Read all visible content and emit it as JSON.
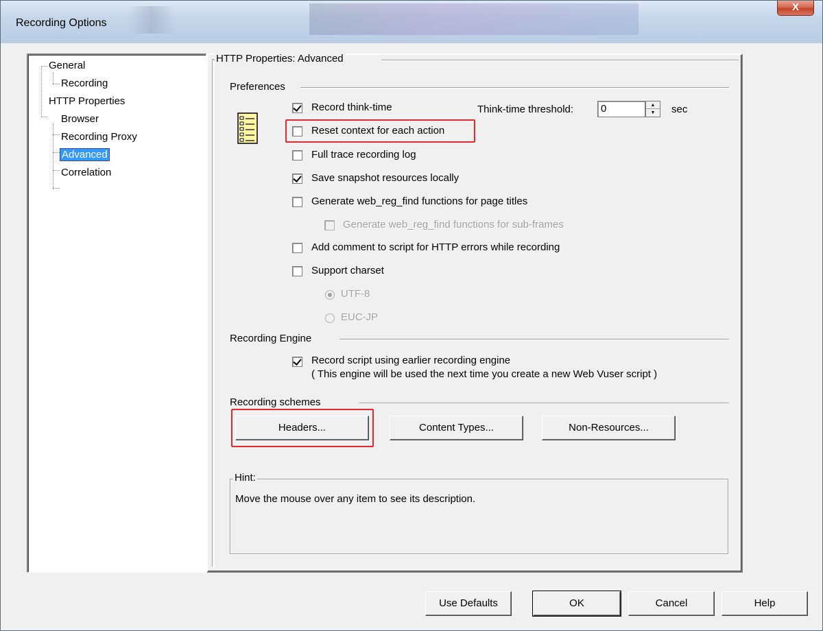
{
  "window": {
    "title": "Recording Options",
    "close_label": "X"
  },
  "tree": {
    "items": [
      {
        "label": "General"
      },
      {
        "label": "Recording"
      },
      {
        "label": "HTTP Properties"
      },
      {
        "label": "Browser"
      },
      {
        "label": "Recording Proxy"
      },
      {
        "label": "Advanced",
        "selected": true
      },
      {
        "label": "Correlation"
      }
    ]
  },
  "panel": {
    "title": "HTTP Properties: Advanced",
    "preferences": {
      "label": "Preferences",
      "record_think_time": {
        "label": "Record think-time",
        "checked": true
      },
      "think_time_threshold": {
        "label": "Think-time threshold:",
        "value": "0",
        "unit": "sec"
      },
      "reset_context": {
        "label": "Reset context for each action",
        "checked": false
      },
      "full_trace": {
        "label": "Full trace recording log",
        "checked": false
      },
      "save_snapshot": {
        "label": "Save snapshot resources locally",
        "checked": true
      },
      "gen_reg_find": {
        "label": "Generate web_reg_find functions for page titles",
        "checked": false
      },
      "gen_reg_find_sub": {
        "label": "Generate web_reg_find functions for sub-frames",
        "checked": false,
        "disabled": true
      },
      "add_comment": {
        "label": "Add comment to script for HTTP errors while recording",
        "checked": false
      },
      "support_charset": {
        "label": "Support charset",
        "checked": false
      },
      "charset_utf8": {
        "label": "UTF-8",
        "selected": true,
        "disabled": true
      },
      "charset_eucjp": {
        "label": "EUC-JP",
        "selected": false,
        "disabled": true
      }
    },
    "recording_engine": {
      "label": "Recording Engine",
      "earlier_engine": {
        "label": "Record script using earlier recording engine",
        "note": "( This engine will be used the next time you create a new Web Vuser script )",
        "checked": true
      }
    },
    "recording_schemes": {
      "label": "Recording schemes",
      "headers_button": "Headers...",
      "content_types_button": "Content Types...",
      "non_resources_button": "Non-Resources..."
    },
    "hint": {
      "label": "Hint:",
      "text": "Move the mouse over any item to see its description."
    }
  },
  "footer": {
    "use_defaults": "Use Defaults",
    "ok": "OK",
    "cancel": "Cancel",
    "help": "Help"
  },
  "colors": {
    "selection": "#3399ff",
    "highlight_box": "#e0282e",
    "dialog_bg": "#f0f0f0"
  }
}
